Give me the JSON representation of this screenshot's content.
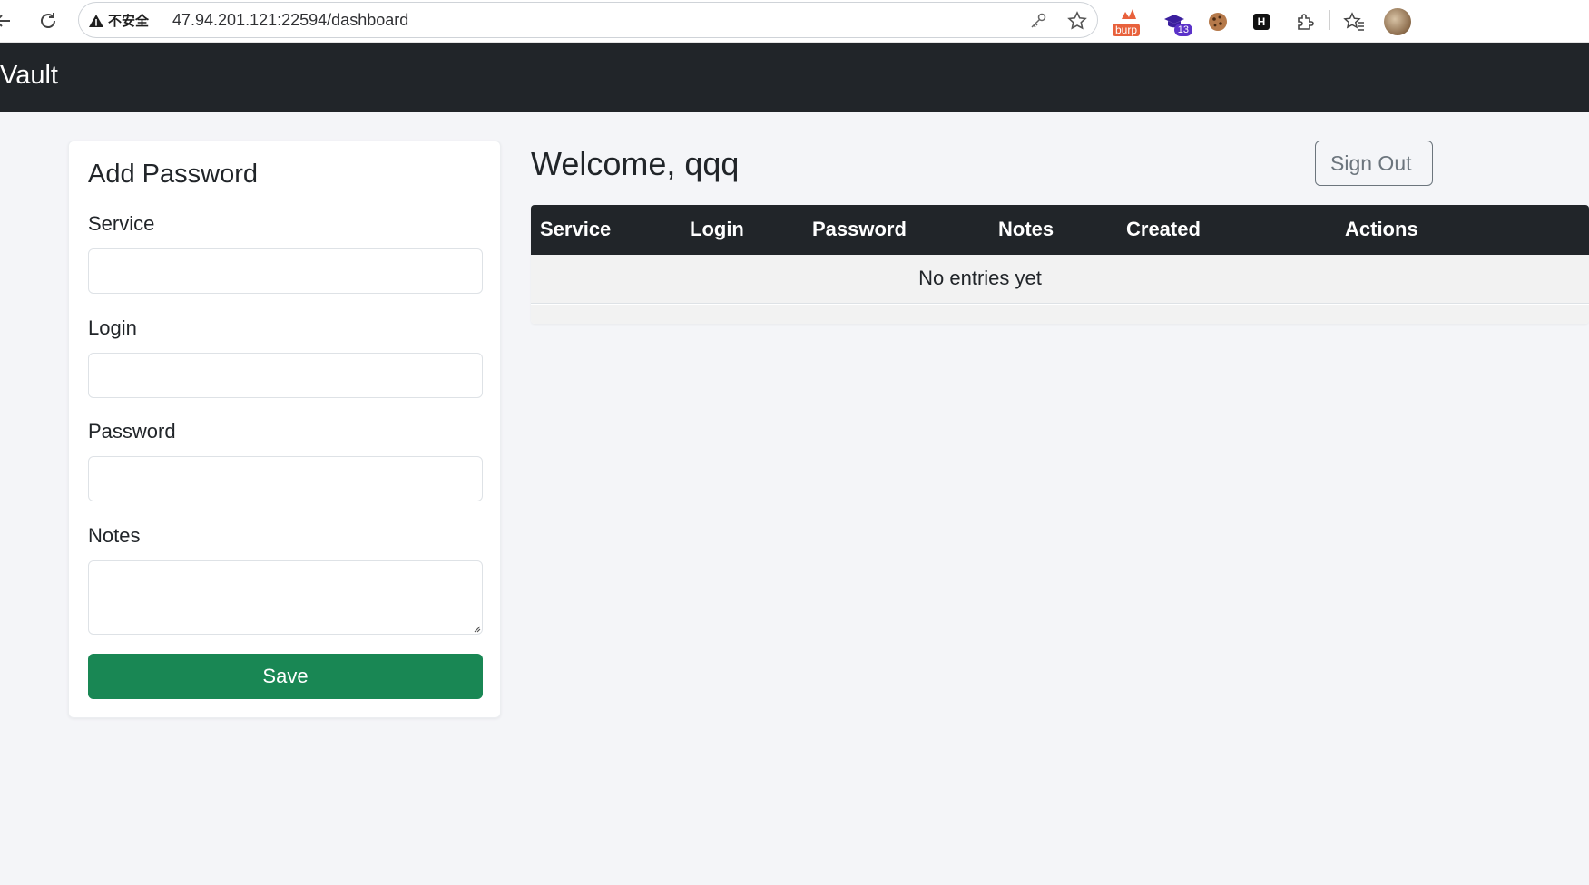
{
  "browser": {
    "security_label": "不安全",
    "url": "47.94.201.121:22594/dashboard",
    "extensions": [
      {
        "name": "burp-suite-extension",
        "badge": "burp"
      },
      {
        "name": "hat-extension",
        "badge": "13"
      },
      {
        "name": "cookie-extension"
      },
      {
        "name": "h-extension",
        "badge": "H"
      },
      {
        "name": "extensions-puzzle"
      }
    ]
  },
  "navbar": {
    "brand": "Vault"
  },
  "form": {
    "title": "Add Password",
    "fields": {
      "service": {
        "label": "Service",
        "value": ""
      },
      "login": {
        "label": "Login",
        "value": ""
      },
      "password": {
        "label": "Password",
        "value": ""
      },
      "notes": {
        "label": "Notes",
        "value": ""
      }
    },
    "save_label": "Save"
  },
  "main": {
    "welcome": "Welcome, qqq",
    "signout_label": "Sign Out",
    "table": {
      "columns": [
        "Service",
        "Login",
        "Password",
        "Notes",
        "Created",
        "Actions"
      ],
      "empty_message": "No entries yet"
    }
  },
  "colors": {
    "navbar": "#212529",
    "save_button": "#198754",
    "background": "#f4f5f8"
  }
}
